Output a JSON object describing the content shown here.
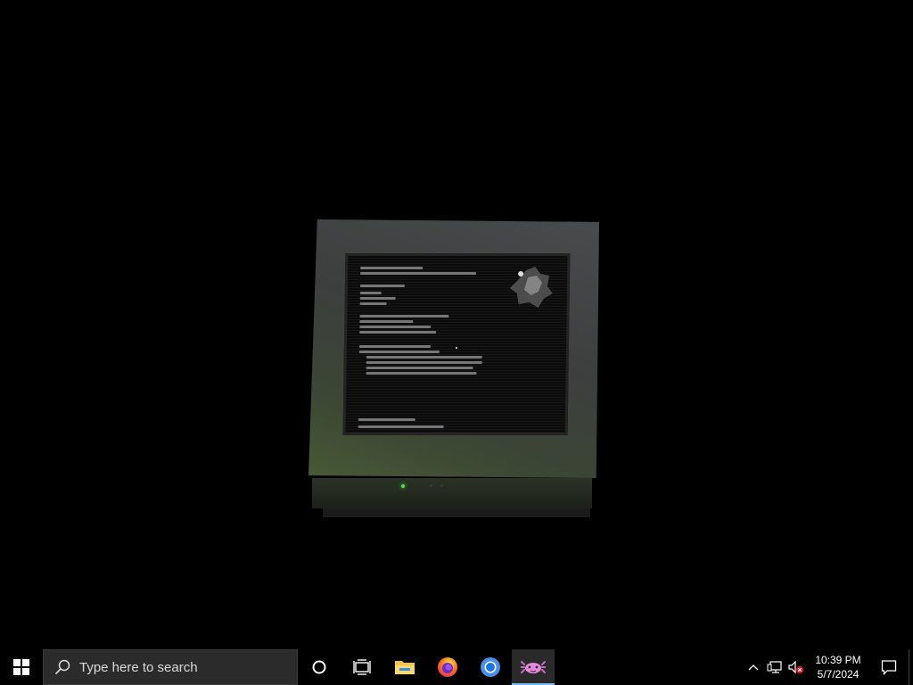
{
  "desktop": {
    "background": "#000000"
  },
  "taskbar": {
    "search_placeholder": "Type here to search",
    "pinned": [
      {
        "name": "Cortana",
        "icon": "cortana-ring-icon"
      },
      {
        "name": "Task View",
        "icon": "task-view-icon"
      },
      {
        "name": "File Explorer",
        "icon": "folder-icon"
      },
      {
        "name": "Firefox",
        "icon": "firefox-icon"
      },
      {
        "name": "Chrome",
        "icon": "chrome-icon"
      },
      {
        "name": "Active app",
        "icon": "axolotl-icon",
        "active": true
      }
    ],
    "accent": "#76b9ed"
  },
  "tray": {
    "time": "10:39 PM",
    "date": "5/7/2024"
  }
}
